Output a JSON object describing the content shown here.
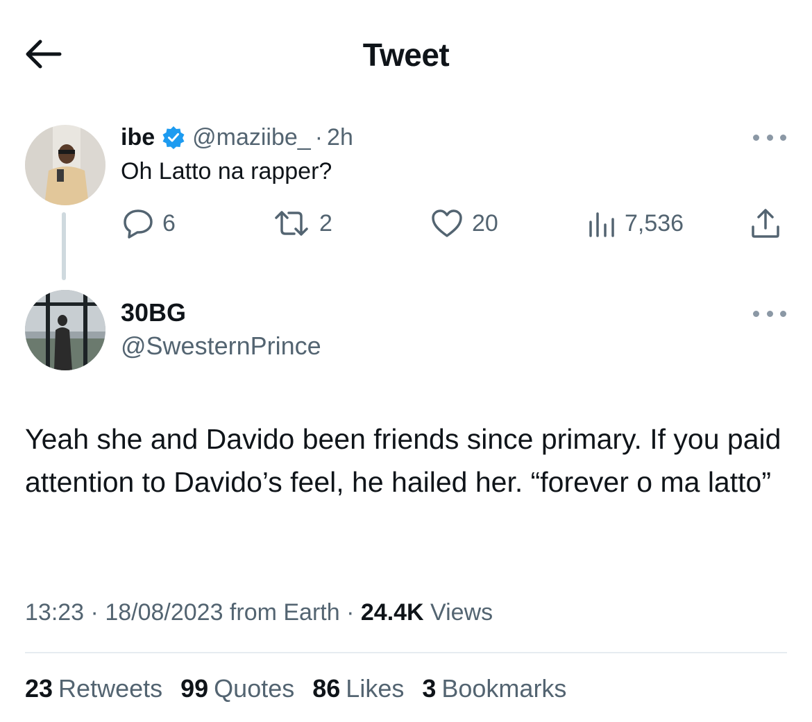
{
  "header": {
    "title": "Tweet",
    "back_icon": "arrow-left-icon"
  },
  "parent_tweet": {
    "name": "ibe",
    "verified": true,
    "handle": "@maziibe_",
    "separator": "·",
    "time": "2h",
    "text": "Oh Latto na rapper?",
    "actions": {
      "replies": "6",
      "retweets": "2",
      "likes": "20",
      "views": "7,536"
    }
  },
  "main_tweet": {
    "name": "30BG",
    "handle": "@SwesternPrince",
    "text": "Yeah she and Davido been friends since primary. If you paid attention to Davido’s feel, he hailed her. “forever o ma latto”",
    "meta": {
      "time": "13:23",
      "sep1": " · ",
      "date": "18/08/2023",
      "source": " from Earth",
      "sep2": " · ",
      "views_count": "24.4K",
      "views_label": " Views"
    },
    "stats": [
      {
        "count": "23",
        "label": "Retweets"
      },
      {
        "count": "99",
        "label": "Quotes"
      },
      {
        "count": "86",
        "label": "Likes"
      },
      {
        "count": "3",
        "label": "Bookmarks"
      }
    ]
  },
  "colors": {
    "text": "#0f1419",
    "secondary": "#536471",
    "verified": "#1d9bf0",
    "divider": "#e6ecf0"
  }
}
